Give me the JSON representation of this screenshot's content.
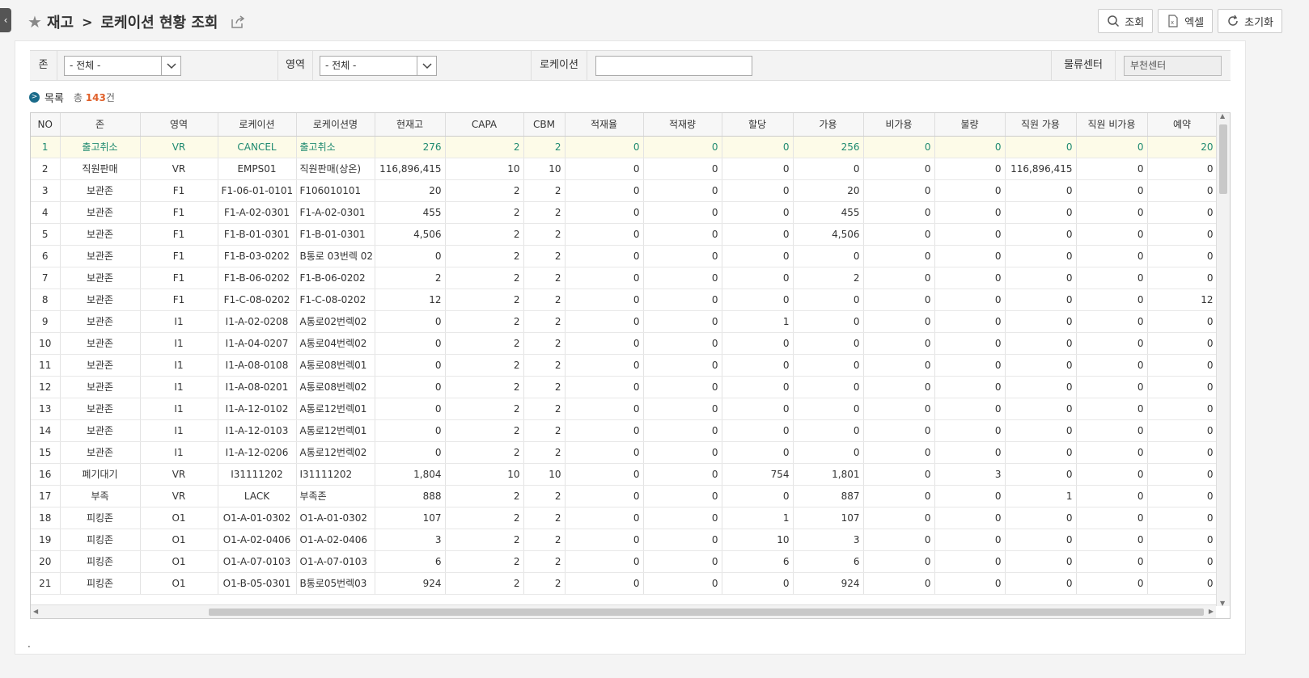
{
  "breadcrumb": {
    "parent": "재고",
    "separator": ">",
    "title": "로케이션 현황 조회"
  },
  "toolbar": {
    "search_label": "조회",
    "excel_label": "엑셀",
    "reset_label": "초기화"
  },
  "filters": {
    "zone_label": "존",
    "zone_value": "- 전체 -",
    "area_label": "영역",
    "area_value": "- 전체 -",
    "location_label": "로케이션",
    "location_value": "",
    "center_label": "물류센터",
    "center_value": "부천센터"
  },
  "list": {
    "title": "목록",
    "total_prefix": "총",
    "total_count": "143",
    "total_suffix": "건"
  },
  "table": {
    "columns": [
      "NO",
      "존",
      "영역",
      "로케이션",
      "로케이션명",
      "현재고",
      "CAPA",
      "CBM",
      "적재율",
      "적재량",
      "할당",
      "가용",
      "비가용",
      "불량",
      "직원 가용",
      "직원 비가용",
      "예약"
    ],
    "rows": [
      [
        "1",
        "출고취소",
        "VR",
        "CANCEL",
        "출고취소",
        "276",
        "2",
        "2",
        "0",
        "0",
        "0",
        "256",
        "0",
        "0",
        "0",
        "0",
        "20"
      ],
      [
        "2",
        "직원판매",
        "VR",
        "EMPS01",
        "직원판매(상온)",
        "116,896,415",
        "10",
        "10",
        "0",
        "0",
        "0",
        "0",
        "0",
        "0",
        "116,896,415",
        "0",
        "0"
      ],
      [
        "3",
        "보관존",
        "F1",
        "F1-06-01-0101",
        "F106010101",
        "20",
        "2",
        "2",
        "0",
        "0",
        "0",
        "20",
        "0",
        "0",
        "0",
        "0",
        "0"
      ],
      [
        "4",
        "보관존",
        "F1",
        "F1-A-02-0301",
        "F1-A-02-0301",
        "455",
        "2",
        "2",
        "0",
        "0",
        "0",
        "455",
        "0",
        "0",
        "0",
        "0",
        "0"
      ],
      [
        "5",
        "보관존",
        "F1",
        "F1-B-01-0301",
        "F1-B-01-0301",
        "4,506",
        "2",
        "2",
        "0",
        "0",
        "0",
        "4,506",
        "0",
        "0",
        "0",
        "0",
        "0"
      ],
      [
        "6",
        "보관존",
        "F1",
        "F1-B-03-0202",
        "B통로 03번렉 02",
        "0",
        "2",
        "2",
        "0",
        "0",
        "0",
        "0",
        "0",
        "0",
        "0",
        "0",
        "0"
      ],
      [
        "7",
        "보관존",
        "F1",
        "F1-B-06-0202",
        "F1-B-06-0202",
        "2",
        "2",
        "2",
        "0",
        "0",
        "0",
        "2",
        "0",
        "0",
        "0",
        "0",
        "0"
      ],
      [
        "8",
        "보관존",
        "F1",
        "F1-C-08-0202",
        "F1-C-08-0202",
        "12",
        "2",
        "2",
        "0",
        "0",
        "0",
        "0",
        "0",
        "0",
        "0",
        "0",
        "12"
      ],
      [
        "9",
        "보관존",
        "I1",
        "I1-A-02-0208",
        "A통로02번렉02",
        "0",
        "2",
        "2",
        "0",
        "0",
        "1",
        "0",
        "0",
        "0",
        "0",
        "0",
        "0"
      ],
      [
        "10",
        "보관존",
        "I1",
        "I1-A-04-0207",
        "A통로04번렉02",
        "0",
        "2",
        "2",
        "0",
        "0",
        "0",
        "0",
        "0",
        "0",
        "0",
        "0",
        "0"
      ],
      [
        "11",
        "보관존",
        "I1",
        "I1-A-08-0108",
        "A통로08번렉01",
        "0",
        "2",
        "2",
        "0",
        "0",
        "0",
        "0",
        "0",
        "0",
        "0",
        "0",
        "0"
      ],
      [
        "12",
        "보관존",
        "I1",
        "I1-A-08-0201",
        "A통로08번렉02",
        "0",
        "2",
        "2",
        "0",
        "0",
        "0",
        "0",
        "0",
        "0",
        "0",
        "0",
        "0"
      ],
      [
        "13",
        "보관존",
        "I1",
        "I1-A-12-0102",
        "A통로12번렉01",
        "0",
        "2",
        "2",
        "0",
        "0",
        "0",
        "0",
        "0",
        "0",
        "0",
        "0",
        "0"
      ],
      [
        "14",
        "보관존",
        "I1",
        "I1-A-12-0103",
        "A통로12번렉01",
        "0",
        "2",
        "2",
        "0",
        "0",
        "0",
        "0",
        "0",
        "0",
        "0",
        "0",
        "0"
      ],
      [
        "15",
        "보관존",
        "I1",
        "I1-A-12-0206",
        "A통로12번렉02",
        "0",
        "2",
        "2",
        "0",
        "0",
        "0",
        "0",
        "0",
        "0",
        "0",
        "0",
        "0"
      ],
      [
        "16",
        "폐기대기",
        "VR",
        "I31111202",
        "I31111202",
        "1,804",
        "10",
        "10",
        "0",
        "0",
        "754",
        "1,801",
        "0",
        "3",
        "0",
        "0",
        "0"
      ],
      [
        "17",
        "부족",
        "VR",
        "LACK",
        "부족존",
        "888",
        "2",
        "2",
        "0",
        "0",
        "0",
        "887",
        "0",
        "0",
        "1",
        "0",
        "0"
      ],
      [
        "18",
        "피킹존",
        "O1",
        "O1-A-01-0302",
        "O1-A-01-0302",
        "107",
        "2",
        "2",
        "0",
        "0",
        "1",
        "107",
        "0",
        "0",
        "0",
        "0",
        "0"
      ],
      [
        "19",
        "피킹존",
        "O1",
        "O1-A-02-0406",
        "O1-A-02-0406",
        "3",
        "2",
        "2",
        "0",
        "0",
        "10",
        "3",
        "0",
        "0",
        "0",
        "0",
        "0"
      ],
      [
        "20",
        "피킹존",
        "O1",
        "O1-A-07-0103",
        "O1-A-07-0103",
        "6",
        "2",
        "2",
        "0",
        "0",
        "6",
        "6",
        "0",
        "0",
        "0",
        "0",
        "0"
      ],
      [
        "21",
        "피킹존",
        "O1",
        "O1-B-05-0301",
        "B통로05번렉03",
        "924",
        "2",
        "2",
        "0",
        "0",
        "0",
        "924",
        "0",
        "0",
        "0",
        "0",
        "0"
      ]
    ]
  },
  "footer_mark": "."
}
